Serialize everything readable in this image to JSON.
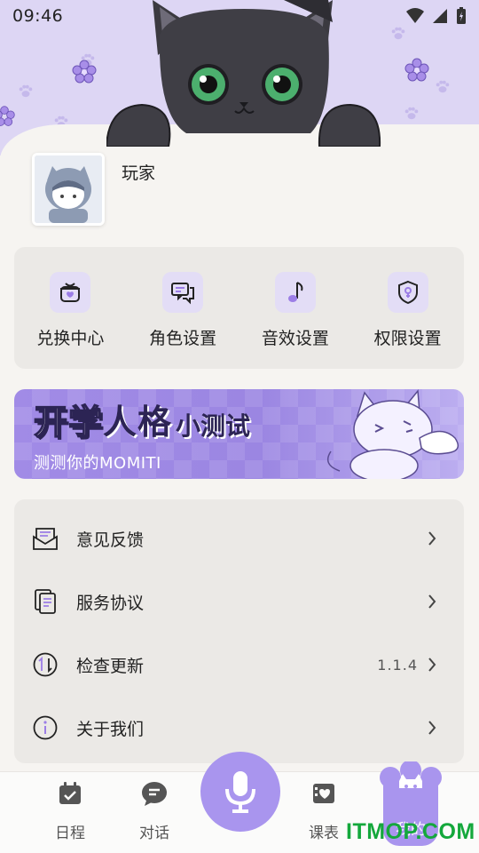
{
  "status_bar": {
    "time": "09:46"
  },
  "profile": {
    "username": "玩家"
  },
  "quick_actions": [
    {
      "label": "兑换中心",
      "icon": "gift-box-icon"
    },
    {
      "label": "角色设置",
      "icon": "chat-bubbles-icon"
    },
    {
      "label": "音效设置",
      "icon": "music-note-icon"
    },
    {
      "label": "权限设置",
      "icon": "shield-icon"
    }
  ],
  "banner": {
    "title_part1": "开学",
    "title_part2": "人格",
    "title_part3": "小测试",
    "subtitle": "测测你的MOMITI"
  },
  "menu": [
    {
      "label": "意见反馈",
      "icon": "feedback-envelope-icon",
      "value": ""
    },
    {
      "label": "服务协议",
      "icon": "document-icon",
      "value": ""
    },
    {
      "label": "检查更新",
      "icon": "update-arrows-icon",
      "value": "1.1.4"
    },
    {
      "label": "关于我们",
      "icon": "info-icon",
      "value": ""
    }
  ],
  "bottom_nav": {
    "schedule": "日程",
    "chat": "对话",
    "timetable": "课表",
    "mine": "我的"
  },
  "watermark": "ITMOP.COM",
  "colors": {
    "accent": "#a995ee",
    "header_bg": "#ddd6f4",
    "card_bg": "#ebe9e6",
    "watermark": "#14a83c"
  }
}
